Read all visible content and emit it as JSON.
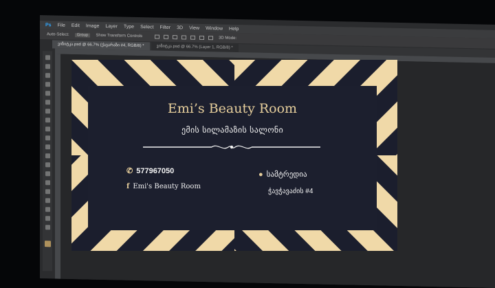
{
  "menu": {
    "logo": "Ps",
    "items": [
      "File",
      "Edit",
      "Image",
      "Layer",
      "Type",
      "Select",
      "Filter",
      "3D",
      "View",
      "Window",
      "Help"
    ]
  },
  "options": {
    "auto_select": "Auto-Select:",
    "group": "Group",
    "show_transform": "Show Transform Controls",
    "mode_3d": "3D Mode:"
  },
  "tabs": [
    {
      "label": "ვიზიტკა.psd @ 66.7% (ქავარაზი #4, RGB/8) *",
      "active": true
    },
    {
      "label": "ვიზიტკა.psd @ 66.7% (Layer 1, RGB/8) *",
      "active": false
    }
  ],
  "card": {
    "title": "Emi’s Beauty Room",
    "subtitle": "ემის სილამაზის სალონი",
    "phone": "577967050",
    "facebook": "Emi's Beauty Room",
    "city": "სამტრედია",
    "street": "ჭავჭავაძის #4"
  },
  "colors": {
    "gold": "#e7cf9c",
    "navy": "#1b1e2d",
    "stripe": "#f0d9a8"
  },
  "icons": {
    "phone": "phone-icon",
    "facebook": "facebook-icon",
    "location": "location-pin-icon"
  }
}
